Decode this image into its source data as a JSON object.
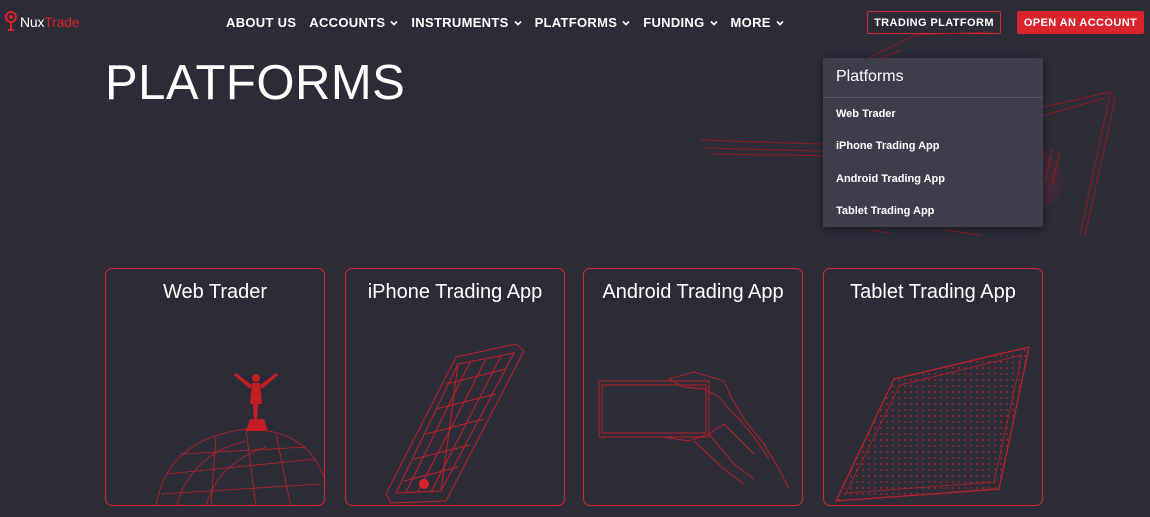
{
  "brand": {
    "logo_a": "Nux",
    "logo_b": "Trade",
    "accent": "#d9242b",
    "background": "#2c2b38"
  },
  "nav": {
    "items": [
      {
        "label": "ABOUT US",
        "has_dropdown": false
      },
      {
        "label": "ACCOUNTS",
        "has_dropdown": true
      },
      {
        "label": "INSTRUMENTS",
        "has_dropdown": true
      },
      {
        "label": "PLATFORMS",
        "has_dropdown": true
      },
      {
        "label": "FUNDING",
        "has_dropdown": true
      },
      {
        "label": "MORE",
        "has_dropdown": true
      }
    ]
  },
  "header": {
    "trading_platform": "TRADING PLATFORM",
    "open_account": "OPEN AN ACCOUNT"
  },
  "page": {
    "title": "PLATFORMS"
  },
  "dropdown": {
    "title": "Platforms",
    "items": [
      "Web Trader",
      "iPhone Trading App",
      "Android Trading App",
      "Tablet Trading App"
    ]
  },
  "cards": [
    {
      "title": "Web Trader",
      "icon": "globe-man-icon"
    },
    {
      "title": "iPhone Trading App",
      "icon": "phone-icon"
    },
    {
      "title": "Android Trading App",
      "icon": "hand-phone-icon"
    },
    {
      "title": "Tablet Trading App",
      "icon": "tablet-icon"
    }
  ]
}
